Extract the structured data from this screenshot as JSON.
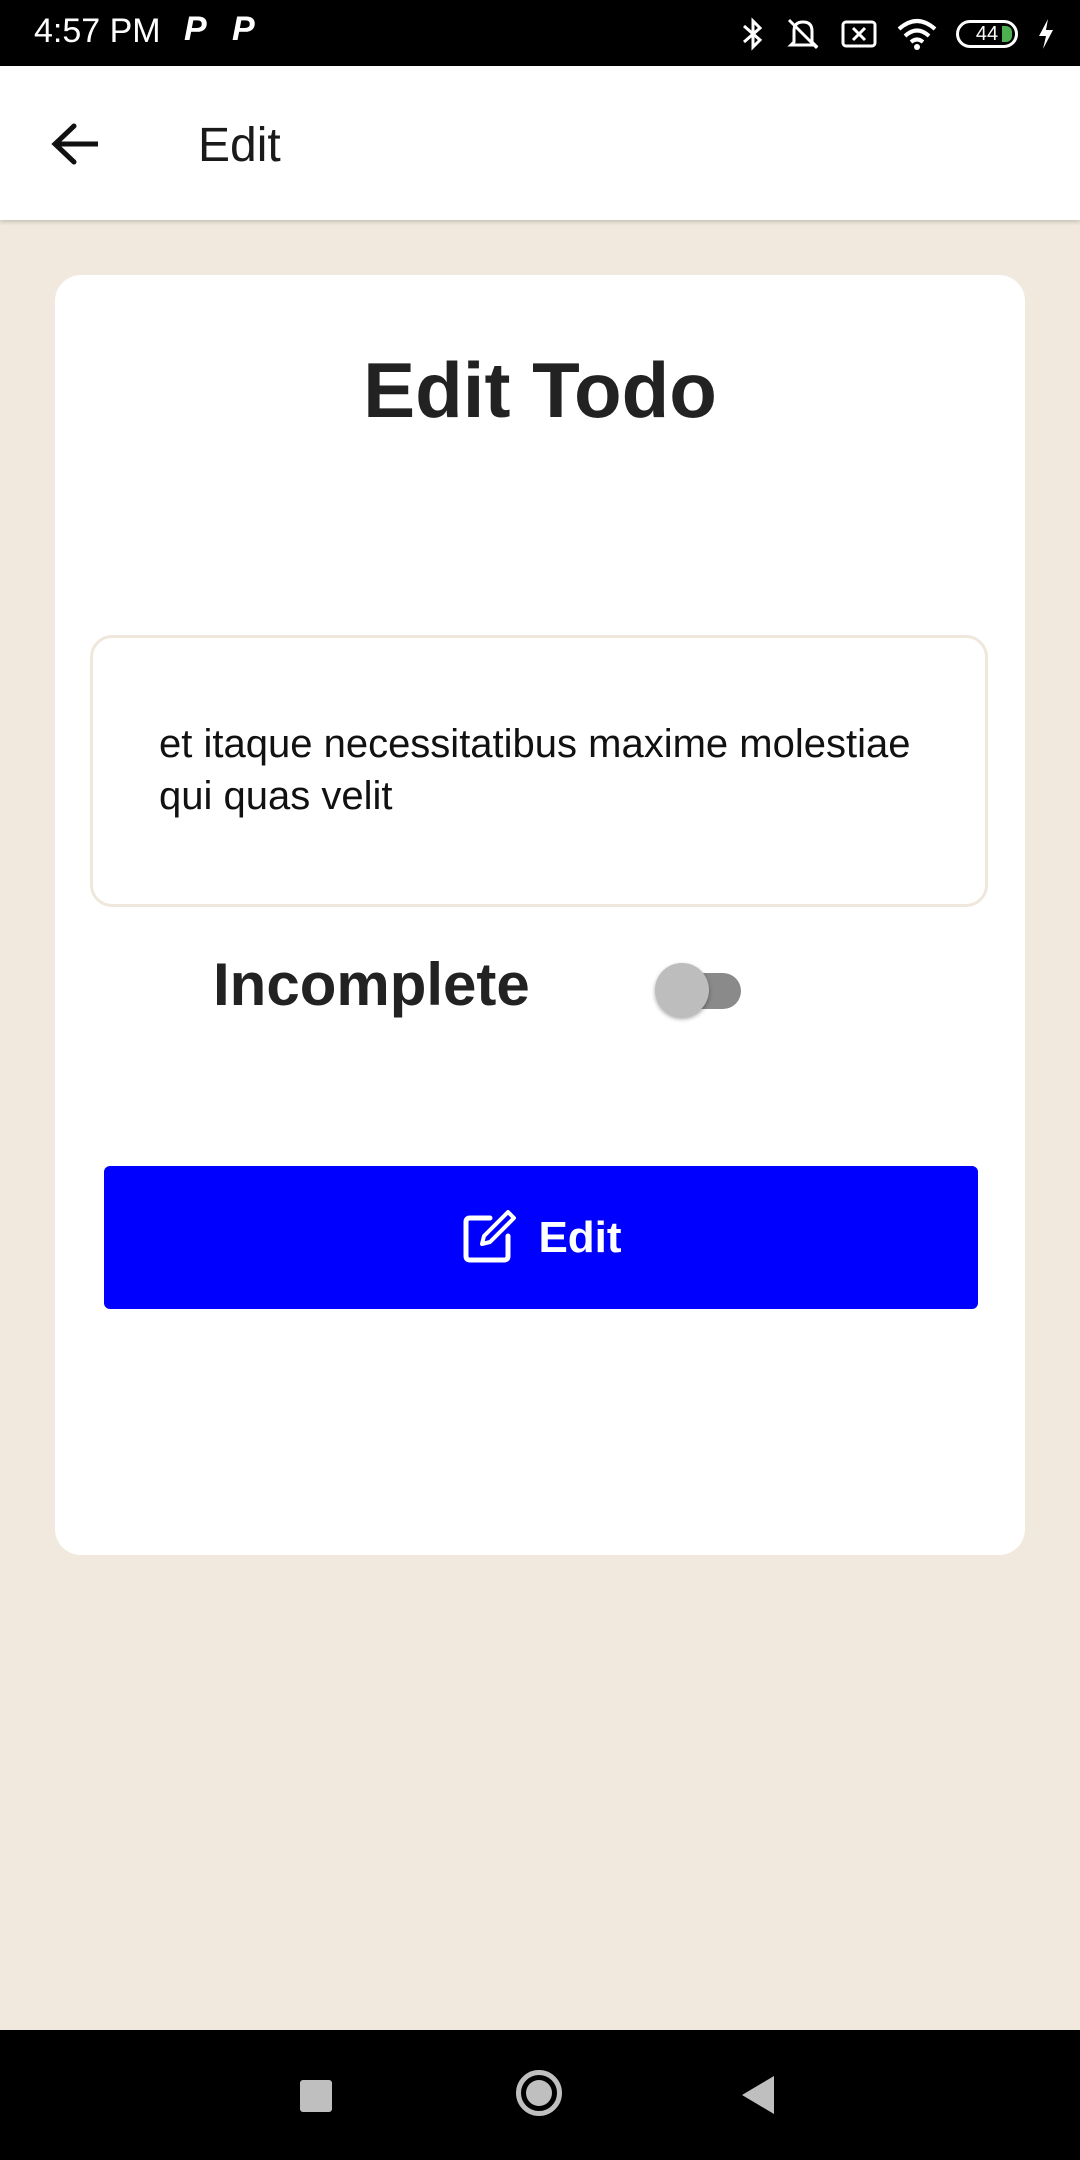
{
  "status_bar": {
    "time": "4:57 PM",
    "notif_1": "P",
    "notif_2": "P",
    "battery_level": "44",
    "icons": [
      "bluetooth-icon",
      "mute-icon",
      "no-sim-icon",
      "wifi-icon",
      "battery-icon",
      "charging-icon"
    ]
  },
  "app_bar": {
    "title": "Edit",
    "back_icon": "arrow-left-icon"
  },
  "card": {
    "title": "Edit Todo",
    "todo_text": "et itaque necessitatibus maxime molestiae qui quas velit",
    "status_label": "Incomplete",
    "toggle_on": false,
    "button_label": "Edit",
    "button_icon": "edit-square-icon"
  },
  "colors": {
    "background": "#f1e9dd",
    "button": "#0000ff",
    "card": "#ffffff"
  },
  "nav_bar": {
    "icons": [
      "recents-icon",
      "home-icon",
      "back-icon"
    ]
  }
}
